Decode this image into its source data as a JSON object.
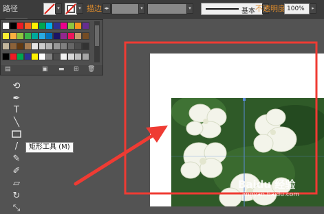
{
  "control_bar": {
    "path_label": "路径",
    "stroke_label": "描边",
    "stroke_style": "基本",
    "opacity_label": "不透明度",
    "opacity_value": "100%"
  },
  "swatches": {
    "row1": [
      "#ffffff",
      "#000000",
      "#ed1c24",
      "#f26522",
      "#fff200",
      "#00a651",
      "#00aeef",
      "#2e3192",
      "#ec008c",
      "#8dc63f",
      "#f7941d",
      "#662d91"
    ],
    "row2": [
      "#f9ed32",
      "#fbb040",
      "#8dc63f",
      "#39b54a",
      "#00a99d",
      "#29abe2",
      "#0072bc",
      "#1b1464",
      "#92278f",
      "#ed145b",
      "#c49a6c",
      "#754c24"
    ],
    "row3": [
      "#c2b59b",
      "#8c6239",
      "#603913",
      "#a67c52",
      "#e6e6e6",
      "#cccccc",
      "#b3b3b3",
      "#999999",
      "#808080",
      "#666666",
      "#4d4d4d",
      "#333333"
    ],
    "row4": [
      "#000000",
      "#ed1c24",
      "#00a651",
      "#2e3192",
      "#fff200",
      "#ffffff",
      "#808080",
      "#4d4d4d",
      "#f2f2f2",
      "#d9d9d9",
      "#bfbfbf",
      "#a6a6a6"
    ]
  },
  "tooltip": {
    "text": "矩形工具 (M)"
  },
  "watermark": {
    "brand": "Baidu 经验",
    "url": "jingyan.baidu.com"
  }
}
